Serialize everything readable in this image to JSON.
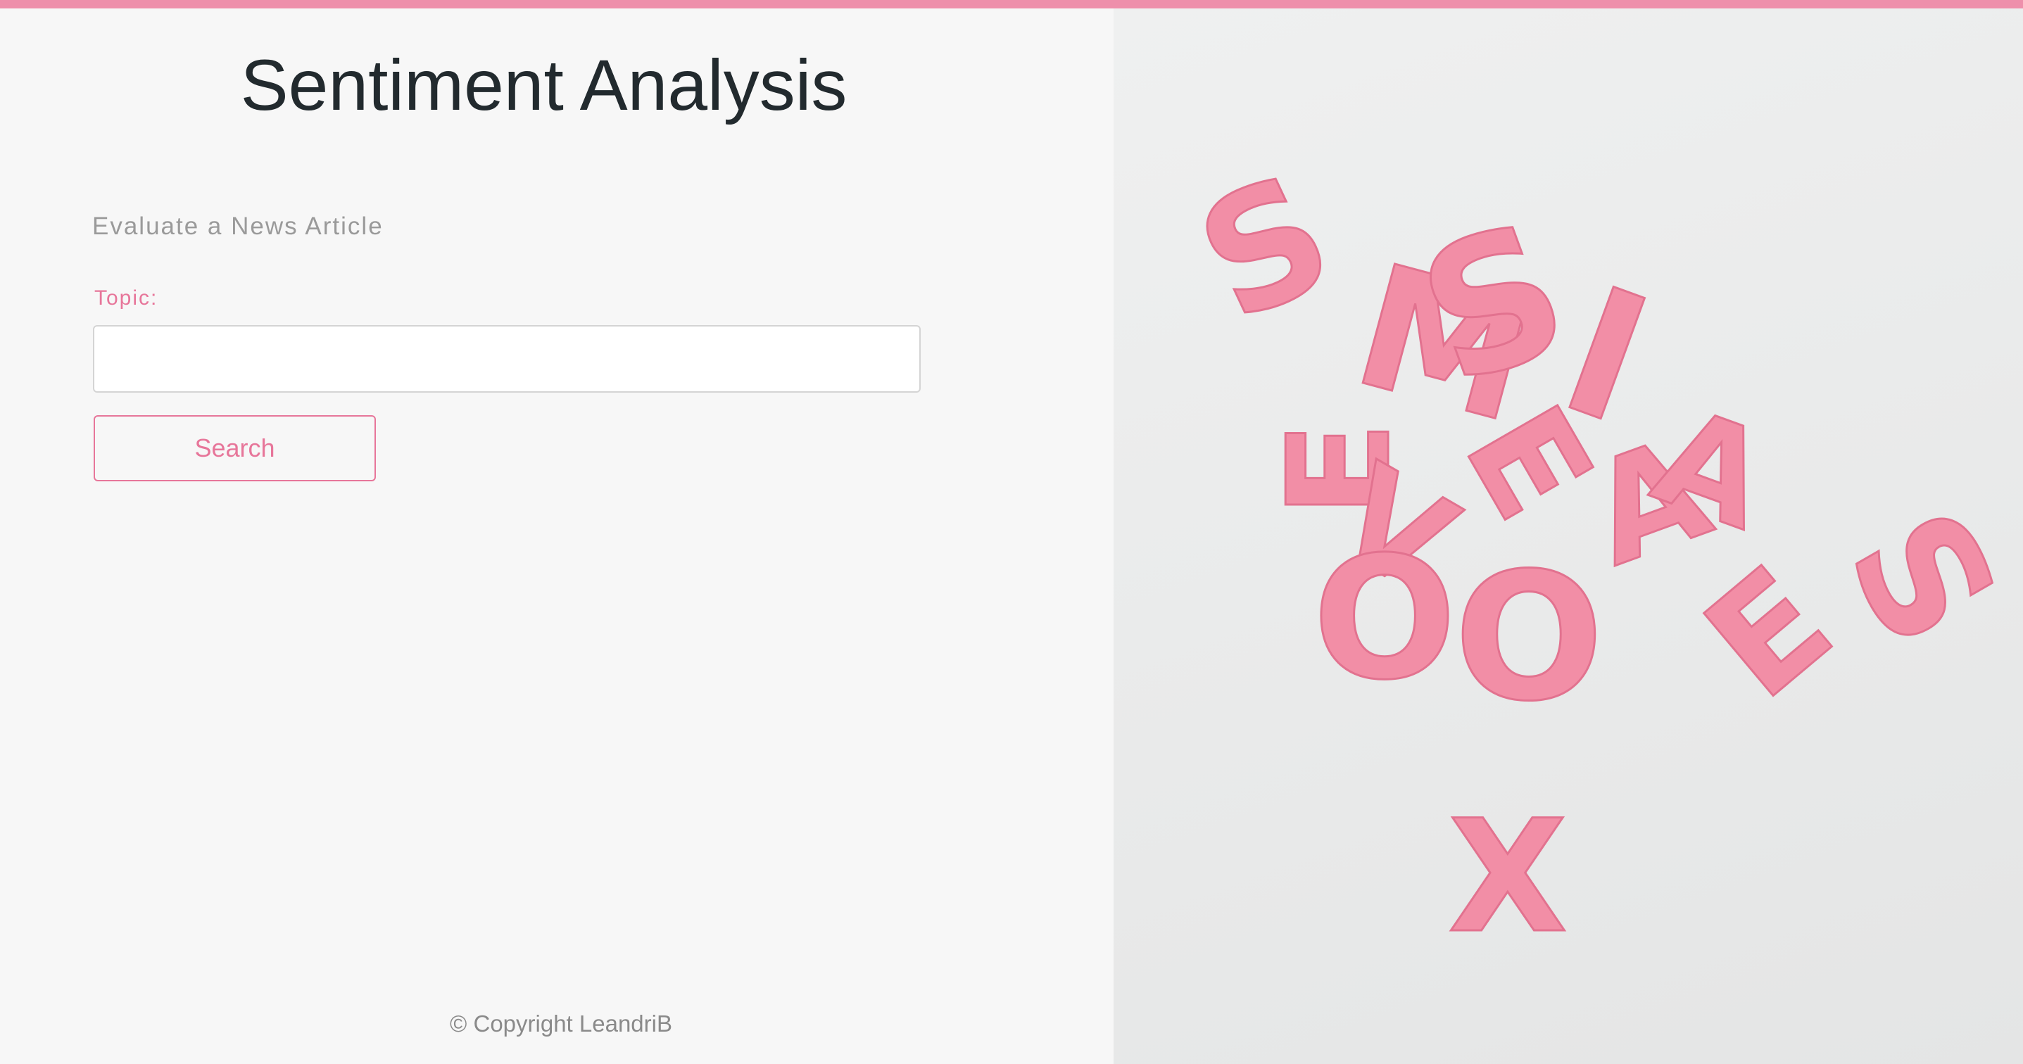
{
  "header": {
    "title": "Sentiment Analysis"
  },
  "form": {
    "subtitle": "Evaluate a News Article",
    "topic_label": "Topic:",
    "topic_value": "",
    "topic_placeholder": "",
    "search_label": "Search"
  },
  "footer": {
    "copyright": "© Copyright LeandriB"
  },
  "hero_image": {
    "description_icon": "pink-letter-tiles-image",
    "letters": [
      "S",
      "M",
      "S",
      "I",
      "E",
      "E",
      "V",
      "O",
      "A",
      "A",
      "O",
      "E",
      "S",
      "X"
    ]
  },
  "colors": {
    "accent": "#ee8fab",
    "text_dark": "#222a2e",
    "muted": "#9a9a9a",
    "letter_pink": "#f28ea6"
  }
}
